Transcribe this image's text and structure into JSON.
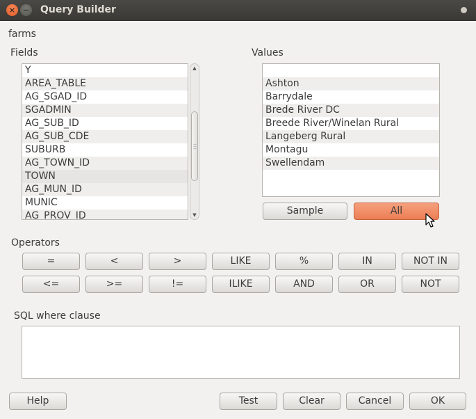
{
  "window": {
    "title": "Query Builder"
  },
  "layer_name": "farms",
  "fields": {
    "label": "Fields",
    "items": [
      "Y",
      "AREA_TABLE",
      "AG_SGAD_ID",
      "SGADMIN",
      "AG_SUB_ID",
      "AG_SUB_CDE",
      "SUBURB",
      "AG_TOWN_ID",
      "TOWN",
      "AG_MUN_ID",
      "MUNIC",
      "AG_PROV_ID"
    ],
    "selected": "TOWN"
  },
  "values": {
    "label": "Values",
    "items": [
      "",
      "Ashton",
      "Barrydale",
      "Brede River DC",
      "Breede River/Winelan Rural",
      "Langeberg Rural",
      "Montagu",
      "Swellendam"
    ],
    "sample_label": "Sample",
    "all_label": "All"
  },
  "operators": {
    "label": "Operators",
    "row1": [
      "=",
      "<",
      ">",
      "LIKE",
      "%",
      "IN",
      "NOT IN"
    ],
    "row2": [
      "<=",
      ">=",
      "!=",
      "ILIKE",
      "AND",
      "OR",
      "NOT"
    ]
  },
  "sql": {
    "label": "SQL where clause",
    "value": ""
  },
  "footer": {
    "help": "Help",
    "test": "Test",
    "clear": "Clear",
    "cancel": "Cancel",
    "ok": "OK"
  },
  "colors": {
    "accent": "#ec7e55",
    "titlebar": "#3c3b37",
    "background": "#f2f1f0"
  }
}
